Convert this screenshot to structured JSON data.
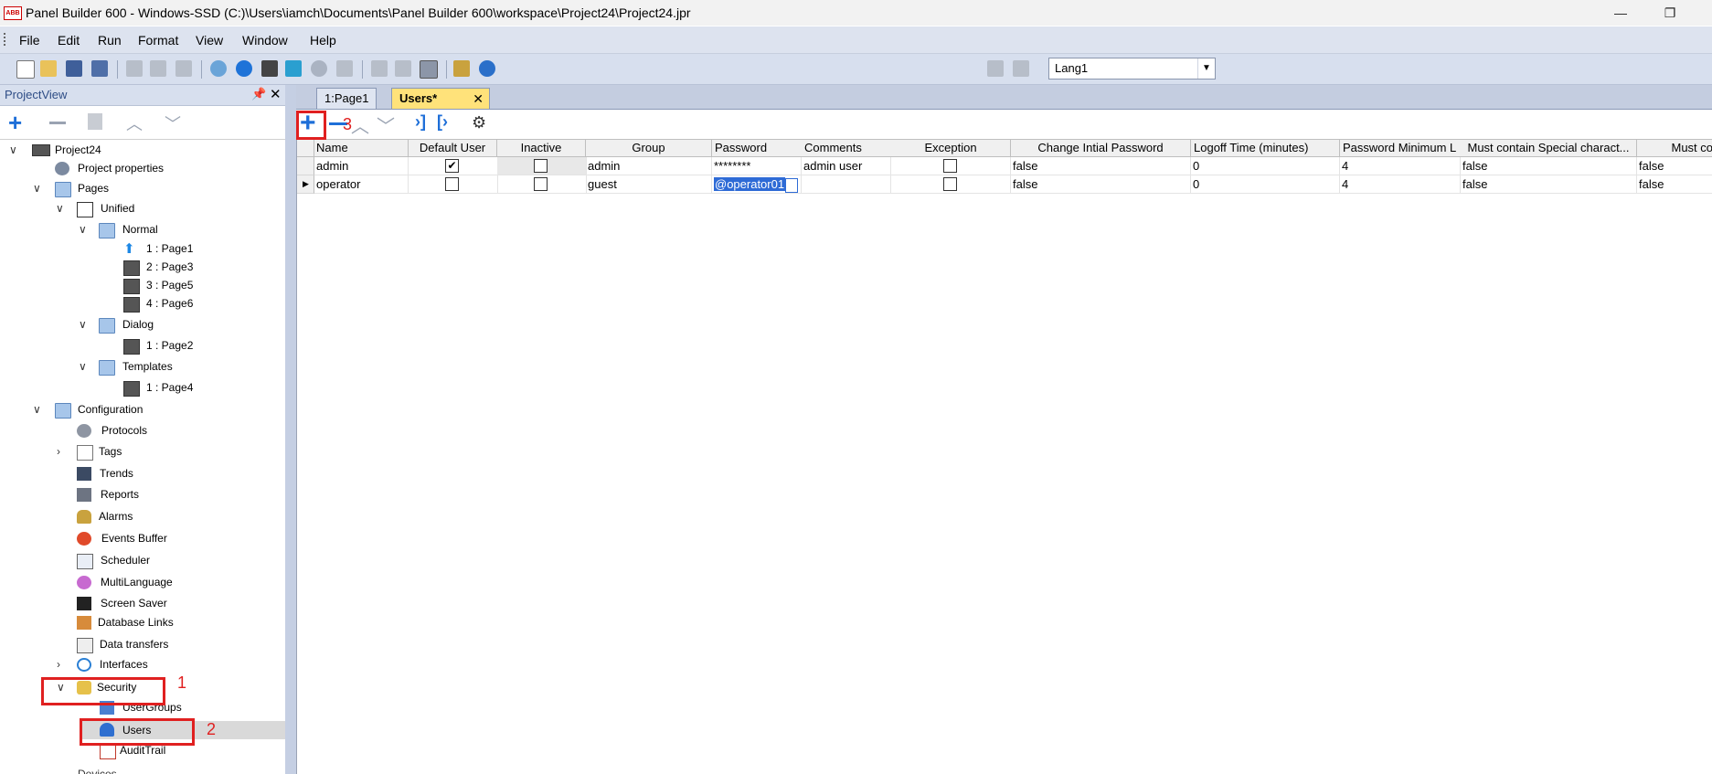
{
  "window": {
    "title": "Panel Builder 600 - Windows-SSD (C:)\\Users\\iamch\\Documents\\Panel Builder 600\\workspace\\Project24\\Project24.jpr",
    "app_icon_text": "ABB"
  },
  "menu": [
    "File",
    "Edit",
    "Run",
    "Format",
    "View",
    "Window",
    "Help"
  ],
  "toolbar": {
    "language": "Lang1"
  },
  "project_view": {
    "title": "ProjectView",
    "tree": {
      "root": "Project24",
      "project_properties": "Project properties",
      "pages": "Pages",
      "unified": "Unified",
      "normal": "Normal",
      "normal_pages": [
        "1 : Page1",
        "2 : Page3",
        "3 : Page5",
        "4 : Page6"
      ],
      "dialog": "Dialog",
      "dialog_pages": [
        "1 : Page2"
      ],
      "templates": "Templates",
      "template_pages": [
        "1 : Page4"
      ],
      "configuration": "Configuration",
      "config_items": [
        "Protocols",
        "Tags",
        "Trends",
        "Reports",
        "Alarms",
        "Events Buffer",
        "Scheduler",
        "MultiLanguage",
        "Screen Saver",
        "Database Links",
        "Data transfers",
        "Interfaces"
      ],
      "security": "Security",
      "security_items": [
        "UserGroups",
        "Users",
        "AuditTrail"
      ],
      "partial": "Devices"
    }
  },
  "tabs": [
    {
      "label": "1:Page1",
      "active": false
    },
    {
      "label": "Users*",
      "active": true
    }
  ],
  "grid": {
    "columns": [
      "Name",
      "Default User",
      "Inactive",
      "Group",
      "Password",
      "Comments",
      "Exception",
      "Change Intial Password",
      "Logoff Time (minutes)",
      "Password Minimum L",
      "Must contain Special charact...",
      "Must co"
    ],
    "rows": [
      {
        "name": "admin",
        "default_user": true,
        "inactive": false,
        "group": "admin",
        "password": "********",
        "comments": "admin user",
        "exception": false,
        "change_initial_password": "false",
        "logoff_time": "0",
        "password_min_length": "4",
        "special_chars": "false",
        "must_co": "false"
      },
      {
        "name": "operator",
        "default_user": false,
        "inactive": false,
        "group": "guest",
        "password": "@operator01",
        "comments": "",
        "exception": false,
        "change_initial_password": "false",
        "logoff_time": "0",
        "password_min_length": "4",
        "special_chars": "false",
        "must_co": "false"
      }
    ]
  },
  "annotations": [
    "1",
    "2",
    "3"
  ],
  "colors": {
    "annotation_red": "#e02020",
    "selection_blue": "#2e6bd6",
    "tab_active": "#ffe27a"
  }
}
